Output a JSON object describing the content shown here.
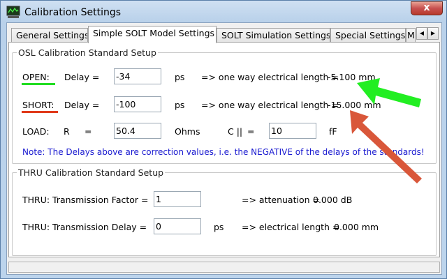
{
  "window": {
    "title": "Calibration Settings",
    "close_symbol": "x"
  },
  "tabs": [
    {
      "label": "General Settings"
    },
    {
      "label": "Simple SOLT Model Settings"
    },
    {
      "label": "SOLT Simulation Settings"
    },
    {
      "label": "Special Settings"
    },
    {
      "label": "M"
    }
  ],
  "tab_scroll": {
    "left": "◀",
    "right": "▶"
  },
  "osl": {
    "title": "OSL Calibration Standard Setup",
    "open": {
      "label": "OPEN:",
      "delay_label": "Delay =",
      "delay_value": "-34",
      "unit": "ps",
      "result_label": "=> one way electrical length =",
      "result_value": "-5.100 mm"
    },
    "short": {
      "label": "SHORT:",
      "delay_label": "Delay =",
      "delay_value": "-100",
      "unit": "ps",
      "result_label": "=> one way electrical length =",
      "result_value": "-15.000 mm"
    },
    "load": {
      "label": "LOAD:",
      "r_label": "R",
      "eq": "=",
      "r_value": "50.4",
      "r_unit": "Ohms",
      "c_label": "C ||",
      "c_eq": "=",
      "c_value": "10",
      "c_unit": "fF"
    },
    "note": "Note: The Delays above are correction values, i.e. the NEGATIVE of the delays of the standards!"
  },
  "thru": {
    "title": "THRU Calibration Standard Setup",
    "factor_label": "THRU: Transmission Factor  =",
    "factor_value": "1",
    "attenuation_label": "=>  attenuation =",
    "attenuation_value": "0.000 dB",
    "delay_label": "THRU: Transmission Delay   =",
    "delay_value": "0",
    "delay_unit": "ps",
    "length_label": "=>  electrical length =",
    "length_value": "0.000 mm"
  },
  "colors": {
    "open_underline": "#22dd22",
    "short_underline": "#e03a1a",
    "green_arrow": "#22ee22",
    "red_arrow": "#d9573a",
    "note_text": "#1a1ad0"
  }
}
